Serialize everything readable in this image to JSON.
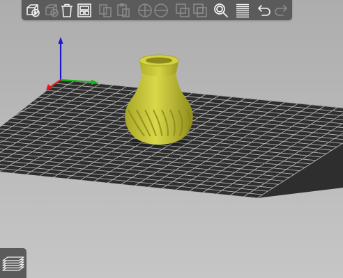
{
  "app": {
    "view": "3D editor view",
    "colors": {
      "background_top": "#adadad",
      "background_bottom": "#c6c6c6",
      "bed_fill": "#2e2e2e",
      "bed_grid": "#b4b4b4",
      "model": "#c7c633",
      "toolbar_bg": "#5b5b5b",
      "icon_enabled": "#f2f2f2",
      "icon_disabled": "#8a8a8a",
      "axis_x": "#e01a1a",
      "axis_y": "#15b515",
      "axis_z": "#1a1ad0"
    }
  },
  "toolbar": {
    "buttons": [
      {
        "name": "add-button",
        "icon": "cube-plus-icon",
        "enabled": true
      },
      {
        "name": "delete-button",
        "icon": "cube-minus-icon",
        "enabled": false
      },
      {
        "name": "delete-all-button",
        "icon": "trash-icon",
        "enabled": true
      },
      {
        "name": "arrange-button",
        "icon": "arrange-icon",
        "enabled": true
      },
      {
        "name": "copy-button",
        "icon": "copy-icon",
        "enabled": false
      },
      {
        "name": "paste-button",
        "icon": "paste-icon",
        "enabled": false
      },
      {
        "name": "add-instance-button",
        "icon": "plus-circle-icon",
        "enabled": false
      },
      {
        "name": "remove-instance-button",
        "icon": "minus-circle-icon",
        "enabled": false
      },
      {
        "name": "split-objects-button",
        "icon": "split-objects-icon",
        "enabled": false
      },
      {
        "name": "split-parts-button",
        "icon": "split-parts-icon",
        "enabled": false
      },
      {
        "name": "search-button",
        "icon": "search-icon",
        "enabled": true
      },
      {
        "name": "layer-editing-button",
        "icon": "layers-lines-icon",
        "enabled": true
      },
      {
        "name": "undo-button",
        "icon": "undo-icon",
        "enabled": true
      },
      {
        "name": "redo-button",
        "icon": "redo-icon",
        "enabled": false
      }
    ]
  },
  "bottom_left": {
    "button": {
      "name": "layers-view-button",
      "icon": "layers-stack-icon",
      "enabled": true
    }
  }
}
